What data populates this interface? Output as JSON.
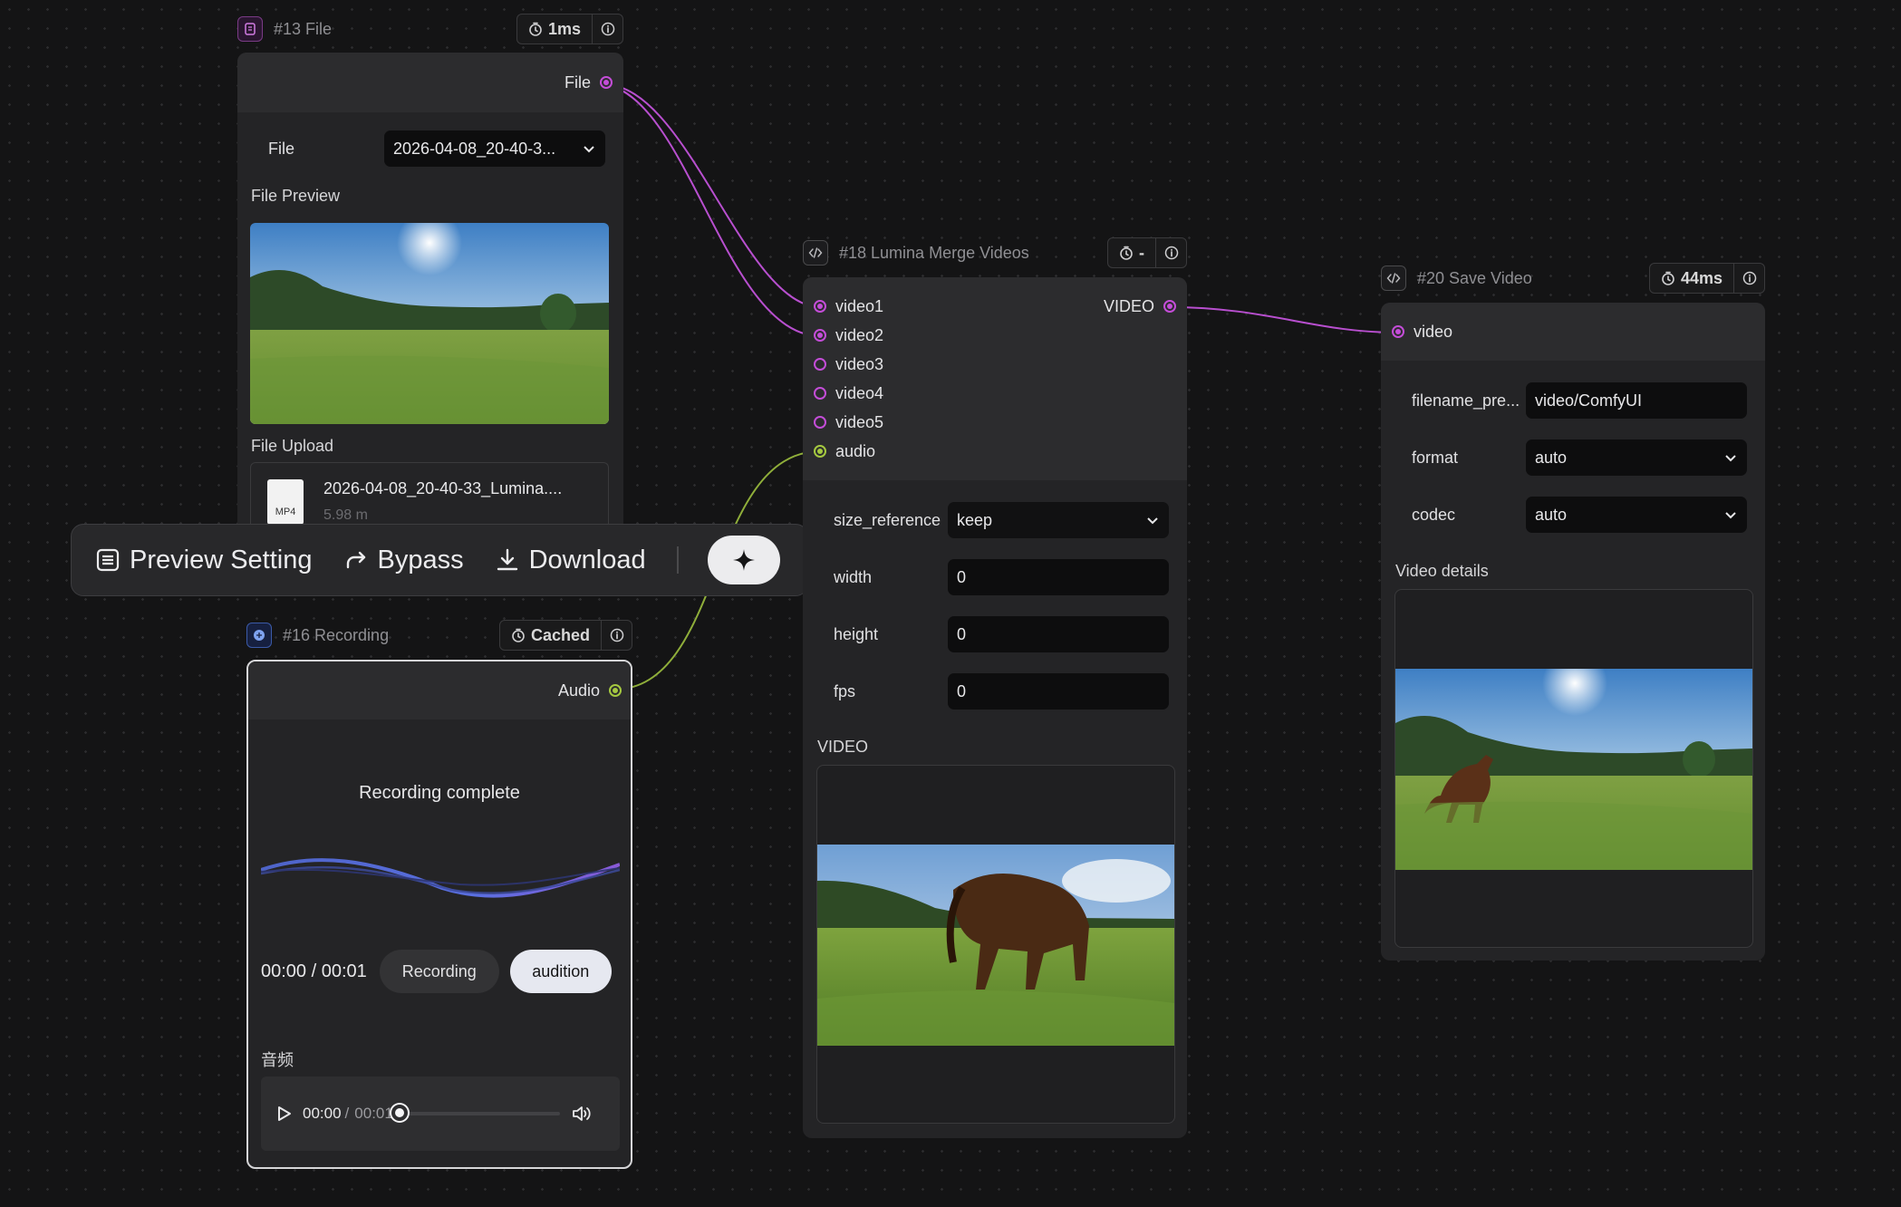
{
  "colors": {
    "wire_video": "#b84fcf",
    "wire_audio": "#8fae3a",
    "canvas": "#141415",
    "node": "#242426"
  },
  "file_node": {
    "id_title": "#13 File",
    "time": "1ms",
    "output_label": "File",
    "file_field_label": "File",
    "file_field_value": "2026-04-08_20-40-3...",
    "preview_label": "File Preview",
    "upload_label": "File Upload",
    "upload_file_name": "2026-04-08_20-40-33_Lumina....",
    "upload_file_type": "MP4",
    "upload_file_size": "5.98 m"
  },
  "toolbar": {
    "preview_setting": "Preview Setting",
    "bypass": "Bypass",
    "download": "Download"
  },
  "recording_node": {
    "id_title": "#16 Recording",
    "status": "Cached",
    "output_label": "Audio",
    "status_text": "Recording complete",
    "time_display": "00:00 / 00:01",
    "recording_button": "Recording",
    "audition_button": "audition",
    "audio_label": "音频",
    "player_current": "00:00",
    "player_separator": "/",
    "player_total": "00:01",
    "player_progress": 0
  },
  "merge_node": {
    "id_title": "#18 Lumina Merge Videos",
    "time": "-",
    "inputs": [
      "video1",
      "video2",
      "video3",
      "video4",
      "video5",
      "audio"
    ],
    "output_label": "VIDEO",
    "size_reference_label": "size_reference",
    "size_reference_value": "keep",
    "width_label": "width",
    "width_value": "0",
    "height_label": "height",
    "height_value": "0",
    "fps_label": "fps",
    "fps_value": "0",
    "video_label": "VIDEO"
  },
  "save_node": {
    "id_title": "#20 Save Video",
    "time": "44ms",
    "input_label": "video",
    "filename_label": "filename_pre...",
    "filename_value": "video/ComfyUI",
    "format_label": "format",
    "format_value": "auto",
    "codec_label": "codec",
    "codec_value": "auto",
    "details_label": "Video details"
  },
  "icons": [
    "file-node-icon",
    "clock-icon",
    "info-icon",
    "chevron-down-icon",
    "list-icon",
    "bypass-icon",
    "download-icon",
    "sparkle-icon",
    "recording-node-icon",
    "code-icon",
    "play-icon",
    "volume-icon"
  ]
}
